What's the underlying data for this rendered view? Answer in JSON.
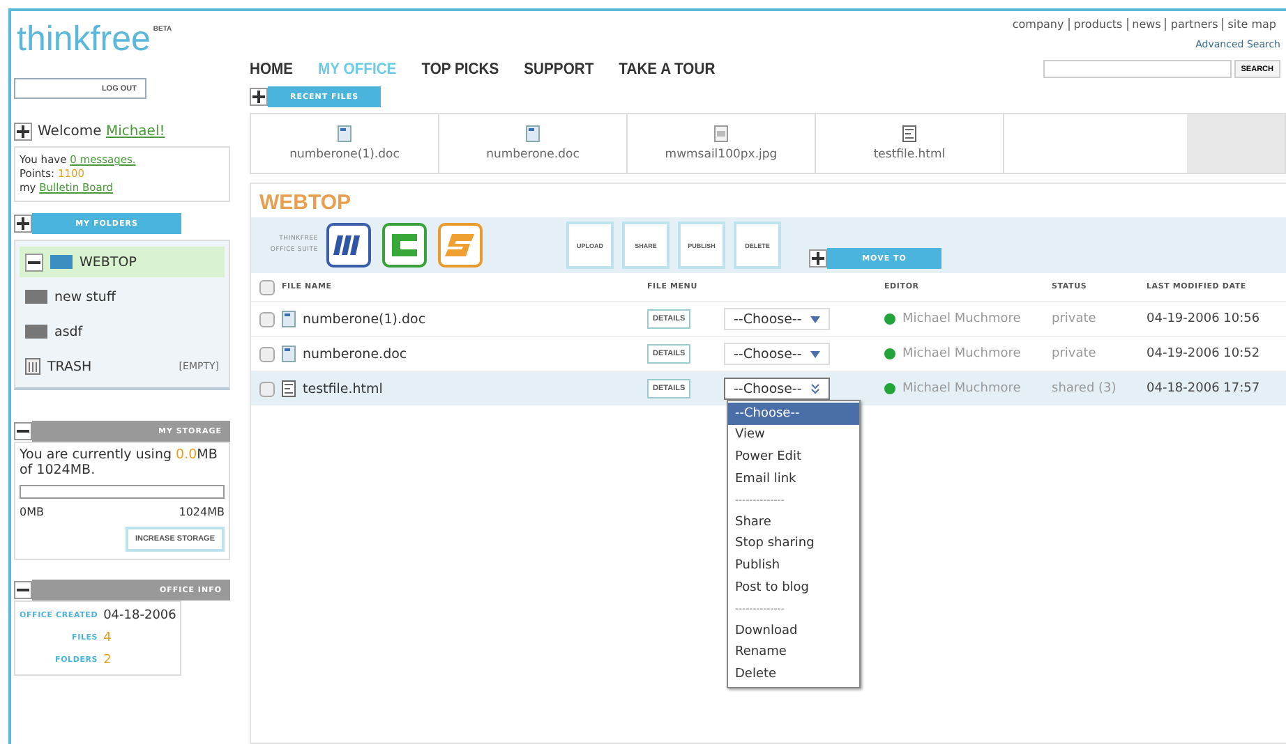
{
  "logo": {
    "name": "thinkfree",
    "badge": "BETA"
  },
  "top_links": [
    "company",
    "products",
    "news",
    "partners",
    "site map"
  ],
  "advanced_search": "Advanced Search",
  "search": {
    "button": "SEARCH"
  },
  "logout": "LOG OUT",
  "nav": [
    {
      "label": "HOME",
      "selected": false
    },
    {
      "label": "MY OFFICE",
      "selected": true
    },
    {
      "label": "TOP PICKS",
      "selected": false
    },
    {
      "label": "SUPPORT",
      "selected": false
    },
    {
      "label": "TAKE A TOUR",
      "selected": false
    }
  ],
  "welcome": {
    "expanded": false,
    "greeting": "Welcome",
    "user": "Michael!",
    "messages_prefix": "You have",
    "messages_link": "0 messages.",
    "points_label": "Points:",
    "points": "1100",
    "bulletin_prefix": "my",
    "bulletin_link": "Bulletin Board"
  },
  "folders": {
    "header": "MY FOLDERS",
    "expanded": false,
    "items": [
      {
        "label": "WEBTOP",
        "kind": "root",
        "selected": true
      },
      {
        "label": "new stuff",
        "kind": "folder",
        "selected": false
      },
      {
        "label": "asdf",
        "kind": "folder",
        "selected": false
      },
      {
        "label": "TRASH",
        "kind": "trash",
        "selected": false,
        "note": "[EMPTY]"
      }
    ]
  },
  "storage": {
    "header": "MY STORAGE",
    "expanded": true,
    "prefix": "You are currently using",
    "used": "0.0",
    "suffix": "MB of 1024MB.",
    "level": 0,
    "min": "0MB",
    "max": "1024MB",
    "button": "INCREASE STORAGE"
  },
  "office_info": {
    "header": "OFFICE INFO",
    "expanded": true,
    "rows": [
      {
        "label": "OFFICE CREATED",
        "value": "04-18-2006"
      },
      {
        "label": "FILES",
        "value": "4"
      },
      {
        "label": "FOLDERS",
        "value": "2"
      }
    ]
  },
  "recent_files": {
    "header": "RECENT FILES",
    "expanded": false,
    "items": [
      {
        "name": "numberone(1).doc",
        "kind": "doc"
      },
      {
        "name": "numberone.doc",
        "kind": "doc"
      },
      {
        "name": "mwmsail100px.jpg",
        "kind": "image"
      },
      {
        "name": "testfile.html",
        "kind": "html"
      }
    ]
  },
  "webtop": {
    "title": "WEBTOP",
    "suite_label": "THINKFREE OFFICE SUITE",
    "suite_apps": [
      {
        "kind": "write"
      },
      {
        "kind": "calc"
      },
      {
        "kind": "show"
      }
    ],
    "actions": [
      "UPLOAD",
      "SHARE",
      "PUBLISH",
      "DELETE"
    ],
    "move_to": {
      "label": "MOVE TO",
      "expanded": false
    },
    "columns": [
      "FILE NAME",
      "FILE MENU",
      "EDITOR",
      "STATUS",
      "LAST MODIFIED DATE"
    ],
    "all_checked": false,
    "rows": [
      {
        "name": "numberone(1).doc",
        "kind": "doc",
        "checked": false,
        "selected": false,
        "details": "DETAILS",
        "choice": "--Choose--",
        "menu_open": false,
        "editor": "Michael Muchmore",
        "color": "#22a43a",
        "status": "private",
        "modified": "04-19-2006 10:56"
      },
      {
        "name": "numberone.doc",
        "kind": "doc",
        "checked": false,
        "selected": false,
        "details": "DETAILS",
        "choice": "--Choose--",
        "menu_open": false,
        "editor": "Michael Muchmore",
        "color": "#22a43a",
        "status": "private",
        "modified": "04-19-2006 10:52"
      },
      {
        "name": "testfile.html",
        "kind": "html",
        "checked": false,
        "selected": true,
        "details": "DETAILS",
        "choice": "--Choose--",
        "menu_open": true,
        "editor": "Michael Muchmore",
        "color": "#22a43a",
        "status": "shared (3)",
        "modified": "04-18-2006 17:57",
        "menu": [
          {
            "label": "--Choose--",
            "kind": "option",
            "selected": true
          },
          {
            "label": "View",
            "kind": "option",
            "selected": false
          },
          {
            "label": "Power Edit",
            "kind": "option",
            "selected": false
          },
          {
            "label": "Email link",
            "kind": "option",
            "selected": false
          },
          {
            "label": "--------------",
            "kind": "separator",
            "selected": false
          },
          {
            "label": "Share",
            "kind": "option",
            "selected": false
          },
          {
            "label": "Stop sharing",
            "kind": "option",
            "selected": false
          },
          {
            "label": "Publish",
            "kind": "option",
            "selected": false
          },
          {
            "label": "Post to blog",
            "kind": "option",
            "selected": false
          },
          {
            "label": "--------------",
            "kind": "separator",
            "selected": false
          },
          {
            "label": "Download",
            "kind": "option",
            "selected": false
          },
          {
            "label": "Rename",
            "kind": "option",
            "selected": false
          },
          {
            "label": "Delete",
            "kind": "option",
            "selected": false
          }
        ]
      }
    ]
  }
}
